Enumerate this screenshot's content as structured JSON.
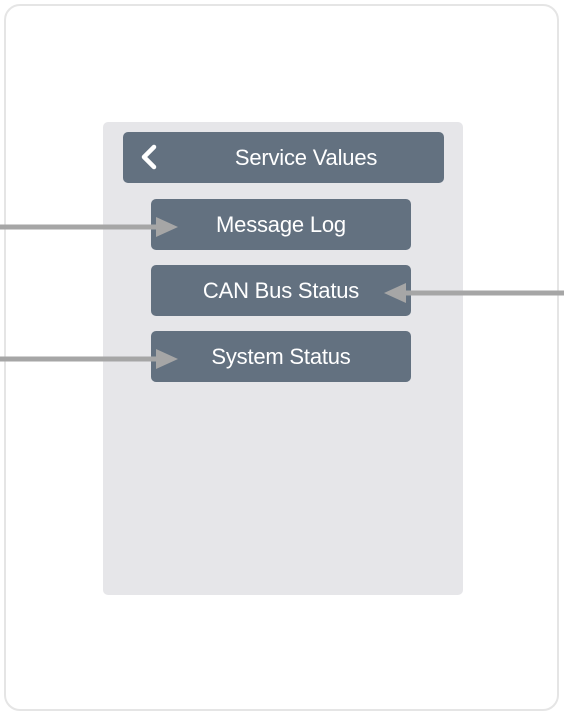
{
  "header": {
    "back_icon": "chevron-left-icon",
    "title": "Service Values"
  },
  "menu": {
    "items": [
      {
        "label": "Message Log"
      },
      {
        "label": "CAN Bus Status"
      },
      {
        "label": "System Status"
      }
    ]
  },
  "colors": {
    "button_bg": "#637180",
    "screen_bg": "#e6e6e9",
    "arrow": "#a6a6a6",
    "text": "#ffffff"
  },
  "icons": {
    "pointer_arrows": "arrow-icon"
  }
}
